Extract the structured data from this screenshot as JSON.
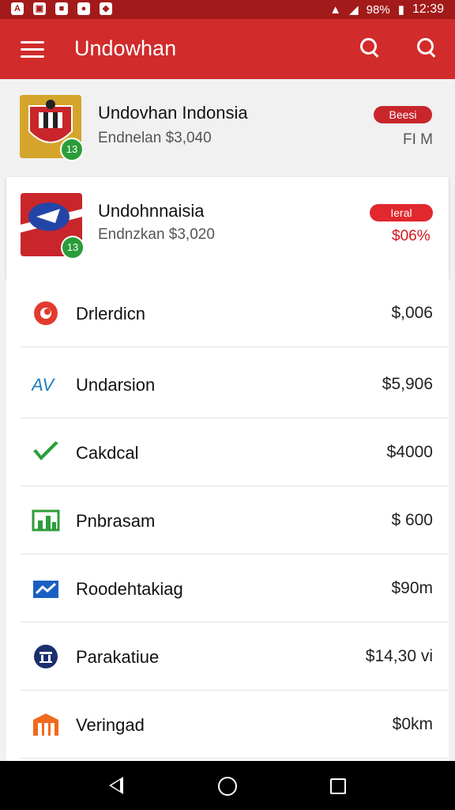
{
  "status_bar": {
    "battery": "98%",
    "time": "12:39"
  },
  "app_bar": {
    "title": "Undowhan"
  },
  "featured": [
    {
      "name": "Undovhan Indonsia",
      "subtitle": "Endnelan $3,040",
      "badge": "13",
      "pill": "Beesi",
      "pill_color": "#c8262b",
      "right_text": "FI M",
      "right_color": "#555555"
    },
    {
      "name": "Undohnnaisia",
      "subtitle": "Endnzkan $3,020",
      "badge": "13",
      "pill": "Ieral",
      "pill_color": "#e0282e",
      "right_text": "$06%",
      "right_color": "#d4161c"
    }
  ],
  "list": [
    {
      "name": "Drlerdicn",
      "price": "$,006",
      "icon": "vodafone-icon"
    },
    {
      "name": "Undarsion",
      "price": "$5,906",
      "icon": "aviva-icon"
    },
    {
      "name": "Cakdcal",
      "price": "$4000",
      "icon": "check-icon"
    },
    {
      "name": "Pnbrasam",
      "price": "$ 600",
      "icon": "chart-icon"
    },
    {
      "name": "Roodehtakiag",
      "price": "$90m",
      "icon": "trend-icon"
    },
    {
      "name": "Parakatiue",
      "price": "$14,30 vi",
      "icon": "bank-icon"
    },
    {
      "name": "Veringad",
      "price": "$0km",
      "icon": "building-icon"
    }
  ],
  "colors": {
    "app_bar": "#d12b2b",
    "status_bar": "#a31a1a"
  }
}
